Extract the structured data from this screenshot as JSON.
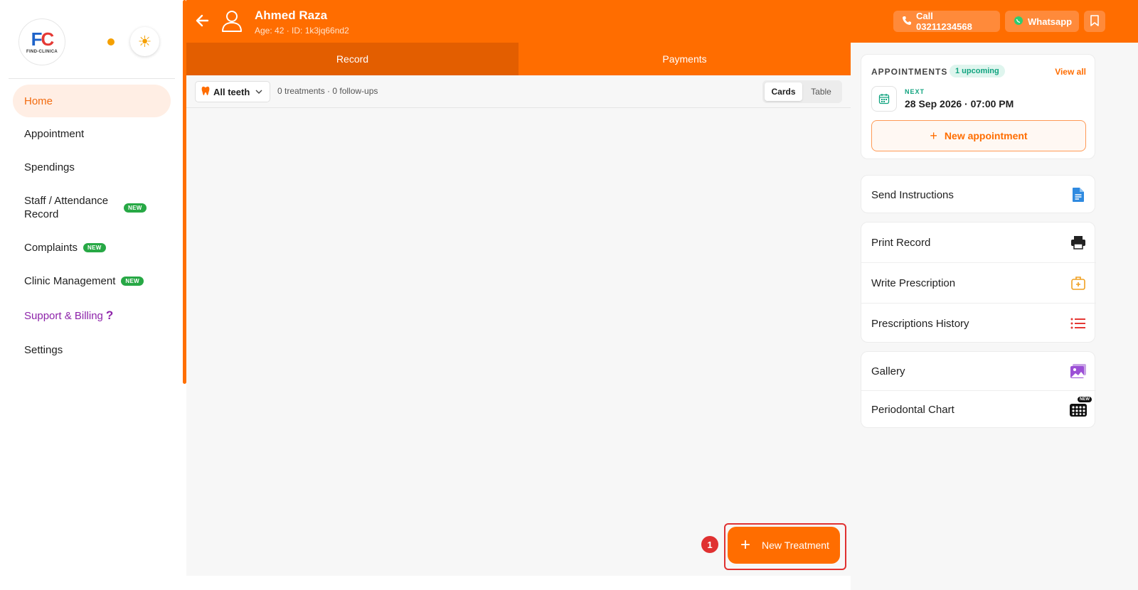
{
  "sidebar": {
    "logo_text": "FC",
    "logo_subtext": "FIND-CLINICA",
    "items": [
      {
        "label": "Home",
        "active": true
      },
      {
        "label": "Appointment"
      },
      {
        "label": "Spendings"
      },
      {
        "label": "Staff / Attendance Record",
        "line1": "Staff / Attendance",
        "line2": "Record",
        "badge": "NEW"
      },
      {
        "label": "Complaints",
        "badge": "NEW"
      },
      {
        "label": "Clinic Management",
        "badge": "NEW"
      },
      {
        "label": "Support & Billing",
        "suffix": "?"
      },
      {
        "label": "Settings"
      }
    ]
  },
  "header": {
    "patient_name": "Ahmed Raza",
    "patient_meta": "Age: 42 · ID: 1k3jq66nd2",
    "call_label": "Call 03211234568",
    "whatsapp_label": "Whatsapp"
  },
  "tabs": [
    {
      "label": "Record",
      "active": true
    },
    {
      "label": "Payments",
      "active": false
    }
  ],
  "filter": {
    "teeth_label": "All teeth",
    "counts": "0 treatments · 0 follow-ups",
    "view_options": [
      "Cards",
      "Table"
    ],
    "selected_view": "Cards"
  },
  "new_treatment": {
    "label": "New Treatment",
    "step": "1"
  },
  "appointments": {
    "title": "APPOINTMENTS",
    "upcoming_badge": "1 upcoming",
    "view_all": "View all",
    "next_label": "NEXT",
    "next_datetime": "28 Sep 2026 · 07:00 PM",
    "new_button": "New appointment"
  },
  "actions": [
    {
      "label": "Send Instructions",
      "icon": "document-icon"
    },
    {
      "label": "Print Record",
      "icon": "printer-icon"
    },
    {
      "label": "Write Prescription",
      "icon": "medical-bag-icon"
    },
    {
      "label": "Prescriptions History",
      "icon": "list-icon"
    },
    {
      "label": "Gallery",
      "icon": "gallery-icon"
    },
    {
      "label": "Periodontal Chart",
      "icon": "grid-chart-icon",
      "badge": "NEW"
    }
  ],
  "colors": {
    "brand_orange": "#ff6d00",
    "active_tab": "#e35e00",
    "new_badge": "#27a845",
    "support_purple": "#8e24aa",
    "accent_green": "#10a37f",
    "highlight_red": "#e03131"
  }
}
